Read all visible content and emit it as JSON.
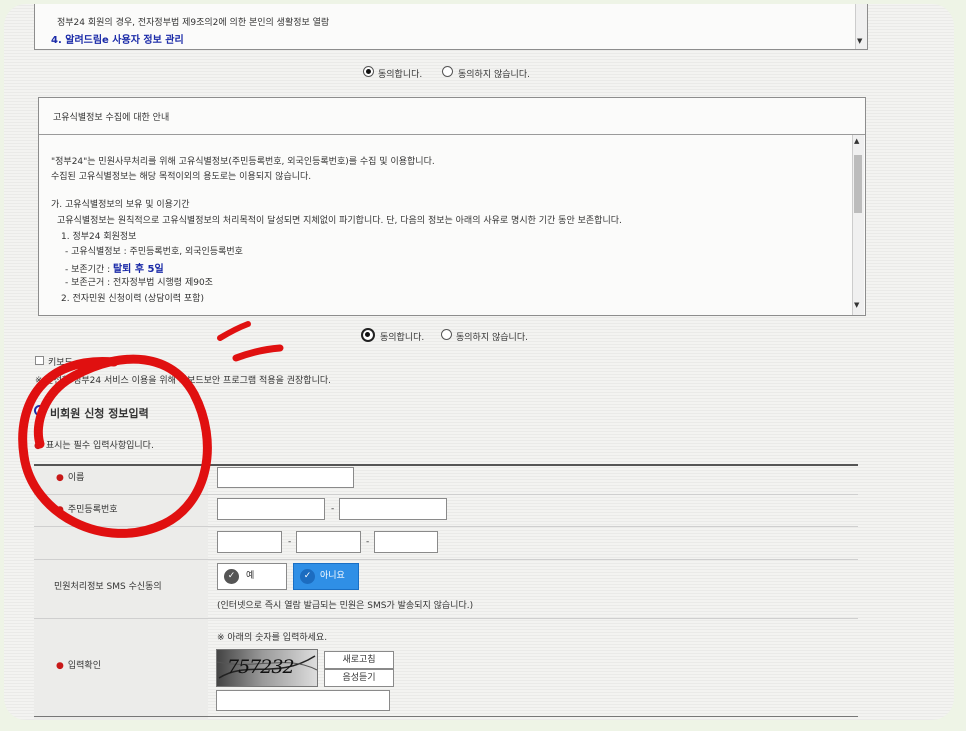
{
  "top_box": {
    "line1": "정부24 회원의 경우, 전자정부법 제9조의2에 의한 본인의 생활정보 열람",
    "line2": "4. 알려드림e 사용자 정보 관리"
  },
  "consent1": {
    "agree": "동의합니다.",
    "disagree": "동의하지 않습니다."
  },
  "uid_box": {
    "title": "고유식별정보 수집에 대한 안내",
    "lines": [
      "\"정부24\"는 민원사무처리를 위해 고유식별정보(주민등록번호, 외국인등록번호)를 수집 및 이용합니다.",
      "수집된 고유식별정보는 해당 목적이외의 용도로는 이용되지 않습니다.",
      "가. 고유식별정보의 보유 및 이용기간",
      "고유식별정보는 원칙적으로 고유식별정보의 처리목적이 달성되면 지체없이 파기합니다. 단, 다음의 정보는 아래의 사유로 명시한 기간 동안 보존합니다.",
      "1. 정부24 회원정보",
      "- 고유식별정보 : 주민등록번호, 외국인등록번호",
      "- 보존기간 : ",
      "탈퇴 후 5일",
      "- 보존근거 : 전자정부법 시행령 제90조",
      "2. 전자민원 신청이력 (상담이력 포함)"
    ]
  },
  "consent2": {
    "agree": "동의합니다.",
    "disagree": "동의하지 않습니다."
  },
  "keyboard": {
    "checkbox_label": "키보드",
    "notice": "※ 안전한 정부24 서비스 이용을 위해 키보드보안 프로그램 적용을 권장합니다."
  },
  "form": {
    "section_title": "비회원 신청 정보입력",
    "required_note": "표시는 필수 입력사항입니다.",
    "name_label": "이름",
    "rrn_label": "주민등록번호",
    "rrn_sep": "-",
    "phone_sep1": "-",
    "phone_sep2": "-",
    "sms_label": "민원처리정보 SMS 수신동의",
    "sms_yes": "예",
    "sms_no": "아니요",
    "sms_note": "(인터넷으로 즉시 열람 발급되는 민원은 SMS가 발송되지 않습니다.)",
    "captcha_hint": "※ 아래의 숫자를 입력하세요.",
    "captcha_label": "입력확인",
    "captcha_text": "757232",
    "refresh_btn": "새로고침",
    "audio_btn": "음성듣기"
  },
  "colors": {
    "accent_blue": "#1a2aa8",
    "required_red": "#c81818",
    "annotation_red": "#e01010",
    "no_button": "#2f8fe6"
  }
}
